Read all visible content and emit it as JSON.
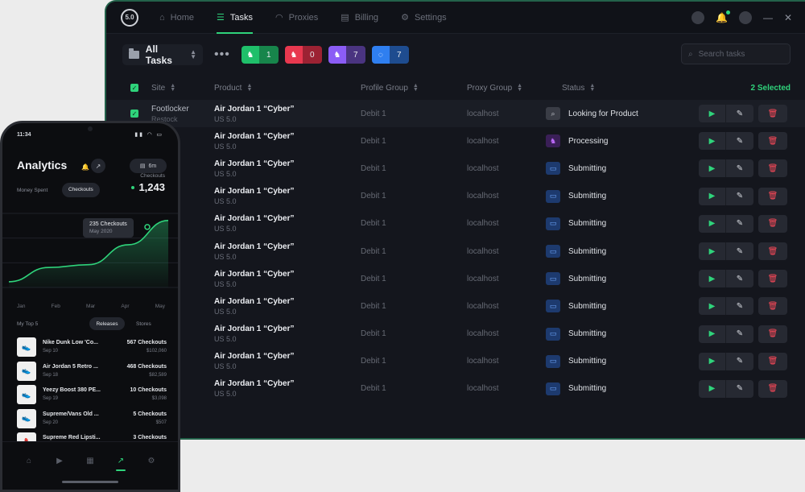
{
  "desktop": {
    "logo_text": "5.0",
    "nav": [
      {
        "label": "Home",
        "icon": "⌂",
        "name": "home"
      },
      {
        "label": "Tasks",
        "icon": "☰",
        "name": "tasks",
        "active": true
      },
      {
        "label": "Proxies",
        "icon": "◠",
        "name": "proxies"
      },
      {
        "label": "Billing",
        "icon": "▤",
        "name": "billing"
      },
      {
        "label": "Settings",
        "icon": "⚙",
        "name": "settings"
      }
    ],
    "toolbar": {
      "task_group_label": "All Tasks",
      "stats": [
        {
          "name": "success",
          "icon": "♞",
          "count": "1",
          "color_icon": "#1fbf6a",
          "color_count": "#17854b"
        },
        {
          "name": "failed",
          "icon": "♞",
          "count": "0",
          "color_icon": "#e8384f",
          "color_count": "#9c2233"
        },
        {
          "name": "processing",
          "icon": "♞",
          "count": "7",
          "color_icon": "#8b5cf6",
          "color_count": "#4a3480"
        },
        {
          "name": "running",
          "icon": "◌",
          "count": "7",
          "color_icon": "#2f7ff0",
          "color_count": "#1e4c8f"
        }
      ],
      "search_placeholder": "Search tasks"
    },
    "table": {
      "headers": {
        "site": "Site",
        "product": "Product",
        "profile": "Profile Group",
        "proxy": "Proxy Group",
        "status": "Status"
      },
      "selected_label": "2 Selected",
      "rows": [
        {
          "site": "Footlocker",
          "site_sub": "Restock",
          "product": "Air Jordan 1 “Cyber”",
          "size": "US 5.0",
          "profile": "Debit 1",
          "proxy": "localhost",
          "status": "Looking for Product",
          "status_type": "search"
        },
        {
          "site": "ocker",
          "site_sub": "",
          "product": "Air Jordan 1 “Cyber”",
          "size": "US 5.0",
          "profile": "Debit 1",
          "proxy": "localhost",
          "status": "Processing",
          "status_type": "process"
        },
        {
          "site": "ocker",
          "site_sub": "",
          "product": "Air Jordan 1 “Cyber”",
          "size": "US 5.0",
          "profile": "Debit 1",
          "proxy": "localhost",
          "status": "Submitting",
          "status_type": "submit"
        },
        {
          "site": "ocker",
          "site_sub": "",
          "product": "Air Jordan 1 “Cyber”",
          "size": "US 5.0",
          "profile": "Debit 1",
          "proxy": "localhost",
          "status": "Submitting",
          "status_type": "submit"
        },
        {
          "site": "ocker",
          "site_sub": "",
          "product": "Air Jordan 1 “Cyber”",
          "size": "US 5.0",
          "profile": "Debit 1",
          "proxy": "localhost",
          "status": "Submitting",
          "status_type": "submit"
        },
        {
          "site": "ocker",
          "site_sub": "",
          "product": "Air Jordan 1 “Cyber”",
          "size": "US 5.0",
          "profile": "Debit 1",
          "proxy": "localhost",
          "status": "Submitting",
          "status_type": "submit"
        },
        {
          "site": "ocker",
          "site_sub": "",
          "product": "Air Jordan 1 “Cyber”",
          "size": "US 5.0",
          "profile": "Debit 1",
          "proxy": "localhost",
          "status": "Submitting",
          "status_type": "submit"
        },
        {
          "site": "ocker",
          "site_sub": "",
          "product": "Air Jordan 1 “Cyber”",
          "size": "US 5.0",
          "profile": "Debit 1",
          "proxy": "localhost",
          "status": "Submitting",
          "status_type": "submit"
        },
        {
          "site": "ocker",
          "site_sub": "",
          "product": "Air Jordan 1 “Cyber”",
          "size": "US 5.0",
          "profile": "Debit 1",
          "proxy": "localhost",
          "status": "Submitting",
          "status_type": "submit"
        },
        {
          "site": "ocker",
          "site_sub": "",
          "product": "Air Jordan 1 “Cyber”",
          "size": "US 5.0",
          "profile": "Debit 1",
          "proxy": "localhost",
          "status": "Submitting",
          "status_type": "submit"
        },
        {
          "site": "ocker",
          "site_sub": "",
          "product": "Air Jordan 1 “Cyber”",
          "size": "US 5.0",
          "profile": "Debit 1",
          "proxy": "localhost",
          "status": "Submitting",
          "status_type": "submit"
        }
      ]
    }
  },
  "phone": {
    "time": "11:34",
    "title": "Analytics",
    "range_label": "6m",
    "money_tab": "Money Spent",
    "checkouts_tab": "Checkouts",
    "checkouts_label": "Checkouts",
    "checkouts_value": "1,243",
    "tooltip_title": "235 Checkouts",
    "tooltip_date": "May 2020",
    "months": [
      "Jan",
      "Feb",
      "Mar",
      "Apr",
      "May"
    ],
    "top_label": "My Top 5",
    "releases_tab": "Releases",
    "stores_tab": "Stores",
    "top_items": [
      {
        "name": "Nike Dunk Low 'Co...",
        "date": "Sep 10",
        "count": "567 Checkouts",
        "amount": "$102,060",
        "icon": "👟"
      },
      {
        "name": "Air Jordan 5 Retro ...",
        "date": "Sep 18",
        "count": "468 Checkouts",
        "amount": "$82,589",
        "icon": "👟"
      },
      {
        "name": "Yeezy Boost 380 PE...",
        "date": "Sep 19",
        "count": "10 Checkouts",
        "amount": "$3,098",
        "icon": "👟"
      },
      {
        "name": "Supreme/Vans Old ...",
        "date": "Sep 20",
        "count": "5 Checkouts",
        "amount": "$507",
        "icon": "👟"
      },
      {
        "name": "Supreme Red Lipsti...",
        "date": "Sep 21",
        "count": "3 Checkouts",
        "amount": "$235",
        "icon": "💄"
      }
    ],
    "bottom_nav": [
      {
        "name": "home",
        "icon": "⌂"
      },
      {
        "name": "tasks",
        "icon": "▶"
      },
      {
        "name": "proxies",
        "icon": "▦"
      },
      {
        "name": "analytics",
        "icon": "↗",
        "active": true
      },
      {
        "name": "settings",
        "icon": "⚙"
      }
    ],
    "chart_data": {
      "type": "area",
      "categories": [
        "Jan",
        "Feb",
        "Mar",
        "Apr",
        "May"
      ],
      "values": [
        20,
        70,
        80,
        150,
        235
      ]
    }
  },
  "colors": {
    "accent": "#2fd37b",
    "danger": "#ff4a5a",
    "background": "#14161d"
  }
}
